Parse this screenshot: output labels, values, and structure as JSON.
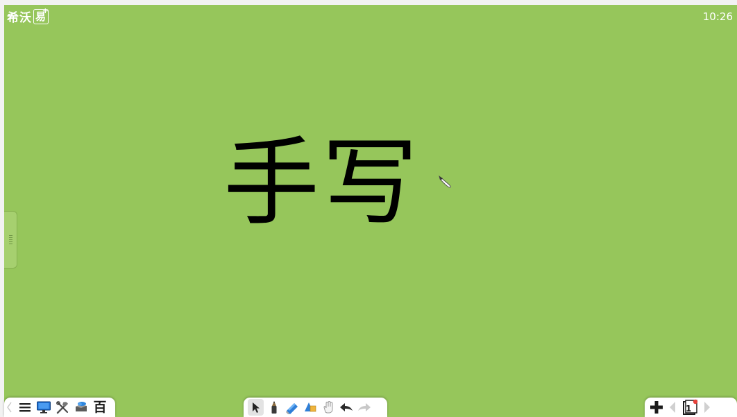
{
  "app": {
    "logo_text": "希沃",
    "logo_box_text": "易",
    "logo_box_sup": "+",
    "clock": "10:26"
  },
  "canvas": {
    "background_color": "#96c65b",
    "handwriting_text": "手写"
  },
  "icons": {
    "side_handle": "grip-icon",
    "pen_cursor": "pen-cursor-icon",
    "left_toolbar": [
      "collapse-left-icon",
      "menu-icon",
      "monitor-icon",
      "tools-icon",
      "cloud-courseware-icon",
      "baike-icon"
    ],
    "center_toolbar": [
      "select-cursor-icon",
      "pen-icon",
      "eraser-icon",
      "shape-icon",
      "roam-hand-icon",
      "undo-icon",
      "redo-icon"
    ],
    "right_toolbar": [
      "add-page-icon",
      "prev-page-icon",
      "page-indicator-icon",
      "next-page-icon"
    ]
  },
  "toolbar": {
    "left_baike_glyph": "百",
    "page_number": "1"
  },
  "colors": {
    "page_badge": "#e8403a",
    "eraser_blue": "#2f7fd8",
    "monitor_blue": "#1f6fd1",
    "disabled_gray": "#c8c8c8"
  }
}
